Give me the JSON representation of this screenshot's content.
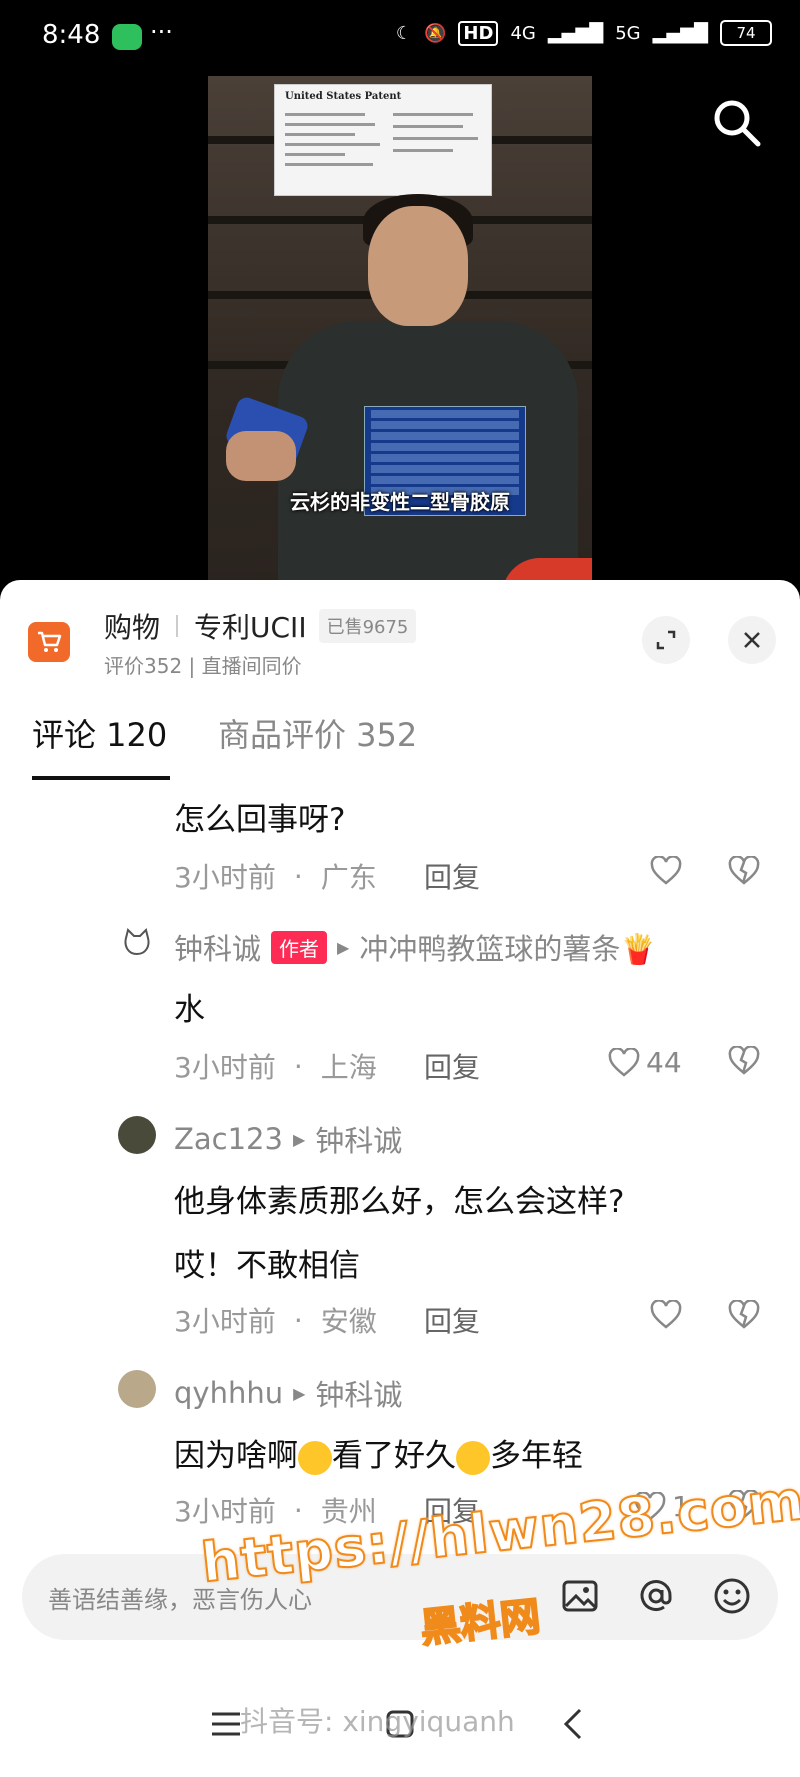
{
  "status_bar": {
    "time": "8:48",
    "battery": "74",
    "network_1": "4G",
    "network_2": "5G",
    "hd": "HD"
  },
  "video": {
    "caption": "云杉的非变性二型骨胶原",
    "patent_title": "United States Patent"
  },
  "shop": {
    "label": "购物",
    "product_name": "专利UCII",
    "sold": "已售9675",
    "subtitle": "评价352 | 直播间同价"
  },
  "tabs": [
    {
      "label": "评论 120",
      "active": true
    },
    {
      "label": "商品评价 352",
      "active": false
    }
  ],
  "comments": [
    {
      "text": "怎么回事呀?",
      "time": "3小时前",
      "location": "广东",
      "reply": "回复",
      "likes": ""
    },
    {
      "user": "钟科诚",
      "author_badge": "作者",
      "reply_to": "冲冲鸭教篮球的薯条🍟",
      "text": "水",
      "time": "3小时前",
      "location": "上海",
      "reply": "回复",
      "likes": "44"
    },
    {
      "user": "Zac123",
      "reply_to": "钟科诚",
      "text_line1": "他身体素质那么好，怎么会这样?",
      "text_line2": "哎！不敢相信",
      "time": "3小时前",
      "location": "安徽",
      "reply": "回复",
      "likes": ""
    },
    {
      "user": "qyhhhu",
      "reply_to": "钟科诚",
      "text_part1": "因为啥啊",
      "text_part2": "看了好久",
      "text_part3": "多年轻",
      "time": "3小时前",
      "location": "贵州",
      "reply": "回复",
      "likes": "1"
    }
  ],
  "input": {
    "placeholder": "善语结善缘，恶言伤人心"
  },
  "watermark": {
    "url": "https://hlwn28.com",
    "cn": "黑料网",
    "douyin": "抖音号: xingyiquanh"
  },
  "colors": {
    "accent": "#fe2c55",
    "cart": "#f26a2a",
    "watermark_stroke": "#f08a1a"
  }
}
